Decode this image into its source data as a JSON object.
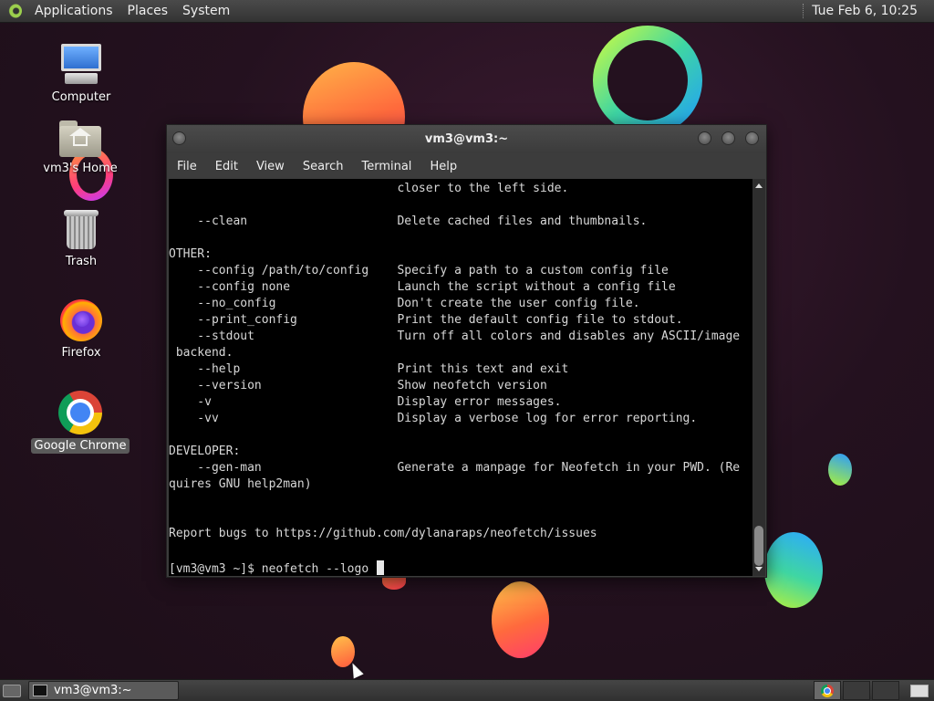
{
  "top_panel": {
    "menus": [
      "Applications",
      "Places",
      "System"
    ],
    "clock": "Tue Feb  6, 10:25"
  },
  "desktop": {
    "icons": [
      {
        "label": "Computer",
        "icon": "computer-icon"
      },
      {
        "label": "vm3's Home",
        "icon": "home-folder-icon"
      },
      {
        "label": "Trash",
        "icon": "trash-icon"
      },
      {
        "label": "Firefox",
        "icon": "firefox-icon"
      },
      {
        "label": "Google Chrome",
        "icon": "chrome-icon",
        "selected": true
      }
    ]
  },
  "terminal": {
    "title": "vm3@vm3:~",
    "menus": [
      "File",
      "Edit",
      "View",
      "Search",
      "Terminal",
      "Help"
    ],
    "lines": [
      "                                closer to the left side.",
      "",
      "    --clean                     Delete cached files and thumbnails.",
      "",
      "OTHER:",
      "    --config /path/to/config    Specify a path to a custom config file",
      "    --config none               Launch the script without a config file",
      "    --no_config                 Don't create the user config file.",
      "    --print_config              Print the default config file to stdout.",
      "    --stdout                    Turn off all colors and disables any ASCII/image",
      " backend.",
      "    --help                      Print this text and exit",
      "    --version                   Show neofetch version",
      "    -v                          Display error messages.",
      "    -vv                         Display a verbose log for error reporting.",
      "",
      "DEVELOPER:",
      "    --gen-man                   Generate a manpage for Neofetch in your PWD. (Re",
      "quires GNU help2man)",
      "",
      "",
      "Report bugs to https://github.com/dylanaraps/neofetch/issues",
      ""
    ],
    "prompt": "[vm3@vm3 ~]$ neofetch --logo "
  },
  "bottom_panel": {
    "task_label": "vm3@vm3:~"
  },
  "colors": {
    "panel": "#3a3a3a",
    "terminal_bg": "#000000",
    "terminal_fg": "#d8d8d8",
    "selection": "#5a5a5a"
  }
}
